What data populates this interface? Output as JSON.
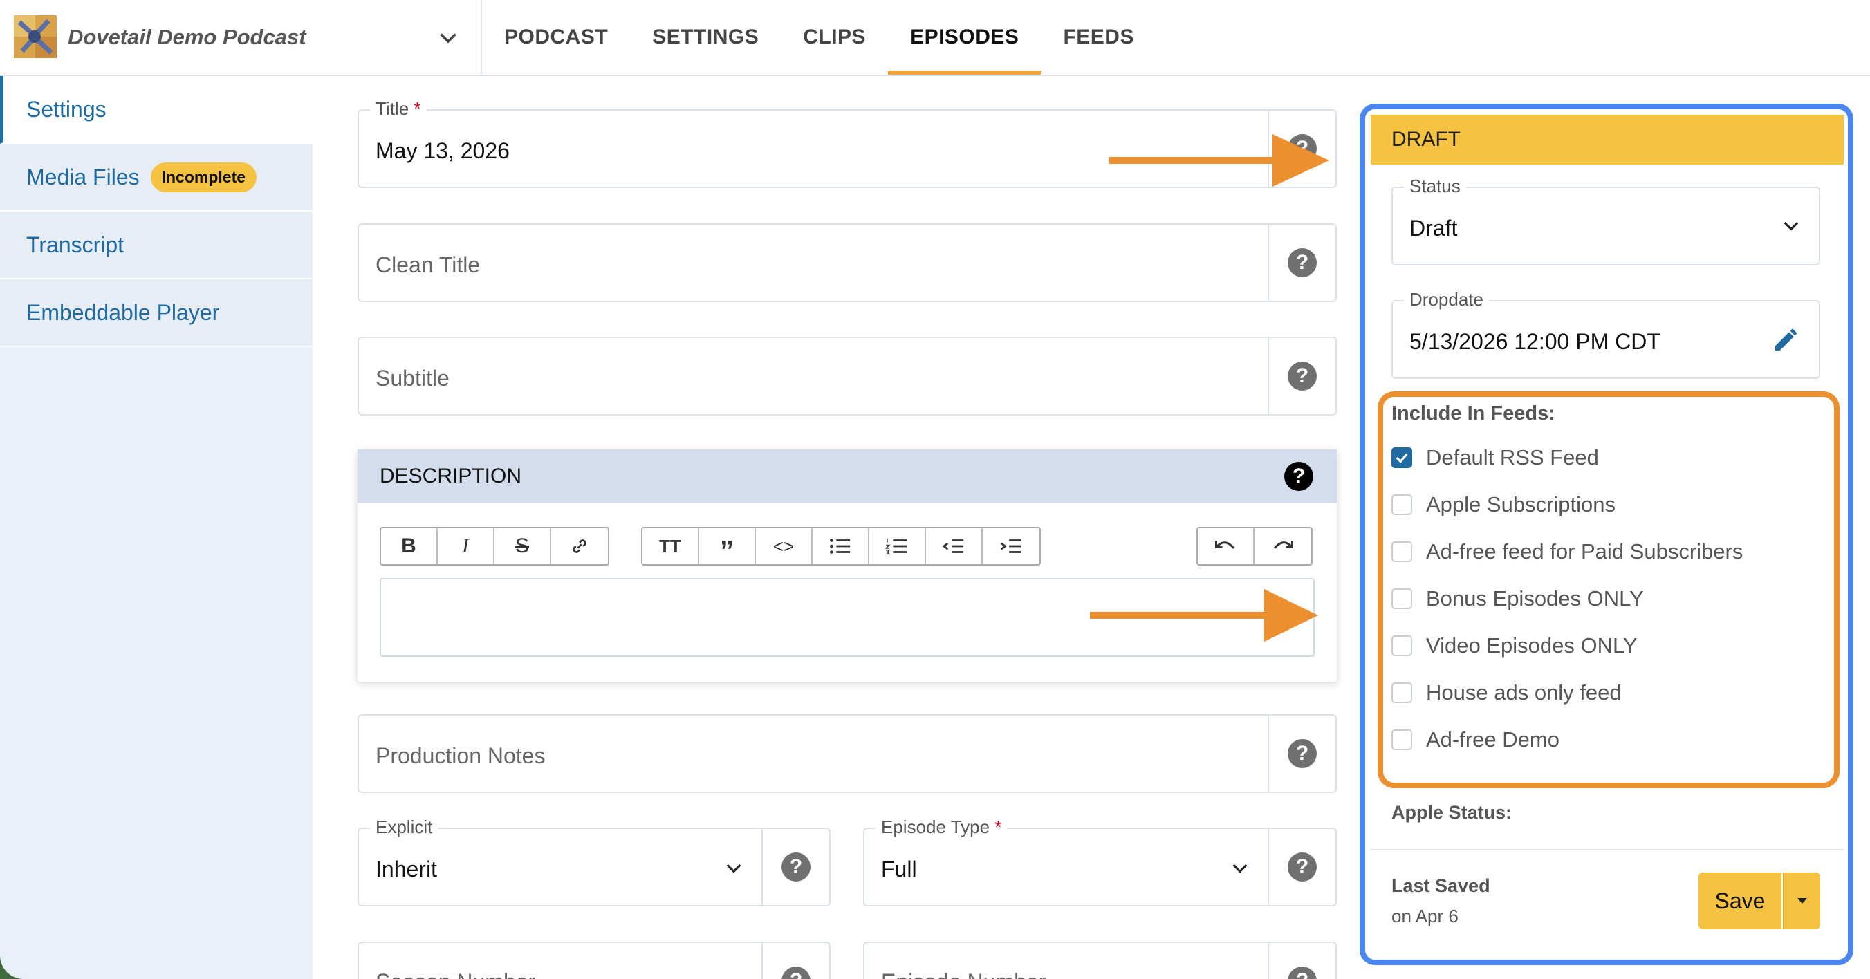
{
  "header": {
    "podcast_name": "Dovetail Demo Podcast",
    "tabs": [
      {
        "label": "PODCAST",
        "active": false
      },
      {
        "label": "SETTINGS",
        "active": false
      },
      {
        "label": "CLIPS",
        "active": false
      },
      {
        "label": "EPISODES",
        "active": true
      },
      {
        "label": "FEEDS",
        "active": false
      }
    ]
  },
  "sidebar": {
    "items": [
      {
        "label": "Settings",
        "active": true
      },
      {
        "label": "Media Files",
        "badge": "Incomplete"
      },
      {
        "label": "Transcript"
      },
      {
        "label": "Embeddable Player"
      }
    ]
  },
  "form": {
    "title": {
      "label": "Title",
      "required": "*",
      "value": "May 13, 2026"
    },
    "clean_title": {
      "placeholder": "Clean Title"
    },
    "subtitle": {
      "placeholder": "Subtitle"
    },
    "description": {
      "heading": "DESCRIPTION",
      "value": ""
    },
    "production_notes": {
      "placeholder": "Production Notes"
    },
    "explicit": {
      "label": "Explicit",
      "value": "Inherit"
    },
    "episode_type": {
      "label": "Episode Type",
      "required": "*",
      "value": "Full"
    },
    "season_number": {
      "label": "Season Number"
    },
    "episode_number": {
      "label": "Episode Number"
    }
  },
  "panel": {
    "header": "DRAFT",
    "status": {
      "label": "Status",
      "value": "Draft"
    },
    "dropdate": {
      "label": "Dropdate",
      "value": "5/13/2026 12:00 PM CDT"
    },
    "include_feeds_title": "Include In Feeds:",
    "feeds": [
      {
        "label": "Default RSS Feed",
        "checked": true
      },
      {
        "label": "Apple Subscriptions",
        "checked": false
      },
      {
        "label": "Ad-free feed for Paid Subscribers",
        "checked": false
      },
      {
        "label": "Bonus Episodes ONLY",
        "checked": false
      },
      {
        "label": "Video Episodes ONLY",
        "checked": false
      },
      {
        "label": "House ads only feed",
        "checked": false
      },
      {
        "label": "Ad-free Demo",
        "checked": false
      }
    ],
    "apple_status_label": "Apple Status:",
    "last_saved_label": "Last Saved",
    "last_saved_date": "on Apr 6",
    "save_label": "Save"
  },
  "colors": {
    "accent_blue": "#1f6aa0",
    "draft_yellow": "#f5c241",
    "highlight_blue": "#4a86f0",
    "highlight_orange": "#ec8f2e"
  }
}
